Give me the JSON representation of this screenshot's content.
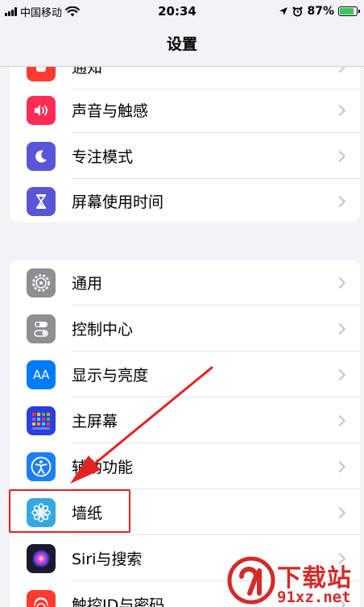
{
  "status_bar": {
    "carrier": "中国移动",
    "time": "20:34",
    "battery": "87%",
    "battery_level": 0.87
  },
  "nav": {
    "title": "设置"
  },
  "group1": [
    {
      "label": "通知",
      "icon": "notifications-icon",
      "color": "#ff3b30"
    },
    {
      "label": "声音与触感",
      "icon": "speaker-icon",
      "color": "#ff2d55"
    },
    {
      "label": "专注模式",
      "icon": "moon-icon",
      "color": "#5856d6"
    },
    {
      "label": "屏幕使用时间",
      "icon": "hourglass-icon",
      "color": "#5856d6"
    }
  ],
  "group2": [
    {
      "label": "通用",
      "icon": "gear-icon",
      "color": "#8e8e93"
    },
    {
      "label": "控制中心",
      "icon": "toggles-icon",
      "color": "#8e8e93"
    },
    {
      "label": "显示与亮度",
      "icon": "aa-icon",
      "icon_text": "AA",
      "color": "#007aff"
    },
    {
      "label": "主屏幕",
      "icon": "home-grid-icon",
      "color": "#2c3ee0"
    },
    {
      "label": "辅助功能",
      "icon": "accessibility-icon",
      "color": "#1c7ef5"
    },
    {
      "label": "墙纸",
      "icon": "wallpaper-flower-icon",
      "color": "#35a8e0"
    },
    {
      "label": "Siri与搜索",
      "icon": "siri-icon",
      "color": "#1a1a2e"
    },
    {
      "label": "触控ID与密码",
      "icon": "fingerprint-icon",
      "color": "#ff3b30"
    }
  ],
  "watermark": {
    "title": "下载站",
    "domain": "91xz.net"
  }
}
